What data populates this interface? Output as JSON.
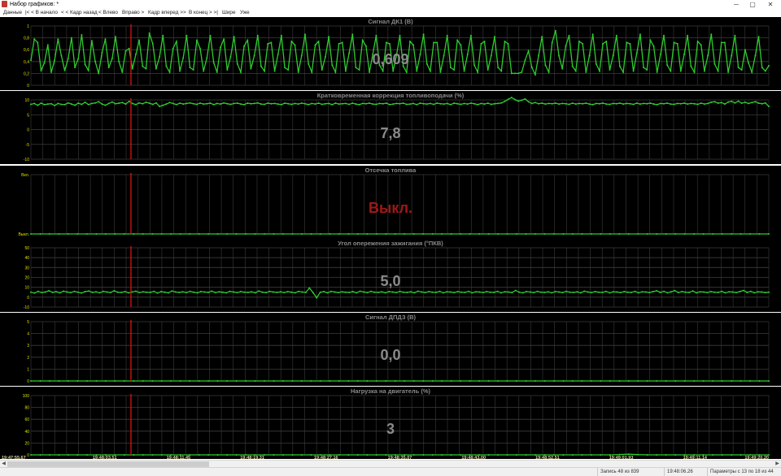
{
  "window": {
    "title": "Набор графиков: *",
    "minimize": "─",
    "maximize": "▢",
    "close": "✕"
  },
  "menu": [
    "Данные",
    "|< < В начало",
    "< < Кадр назад",
    "< Влево",
    "Вправо >",
    "Кадр вперед >>",
    "В конец > >|",
    "Шире",
    "Уже"
  ],
  "colors": {
    "background": "#000000",
    "grid": "#3c3c3c",
    "series": "#2ecc2e",
    "cursor": "#e01010",
    "title": "#8a8a8a",
    "big_value": "#8a8a8a",
    "big_value_alert": "#a01818",
    "axis_text": "#e0e000",
    "x_text": "#d6d6a0"
  },
  "x_axis": {
    "time_labels": [
      "19:47:55.67",
      "19:48:03.51",
      "19:48:11.45",
      "19:48:19.31",
      "19:48:27.16",
      "19:48:35.07",
      "19:48:43.00",
      "19:48:52.51",
      "19:49:01.93",
      "19:49:11.14",
      "19:49:20.20"
    ]
  },
  "chart_data": [
    {
      "type": "line",
      "title": "Сигнал ДК1  (В)",
      "current_value": "0,609",
      "y_ticks": [
        "1",
        "0,8",
        "0,6",
        "0,4",
        "0,2",
        "0"
      ],
      "ylim": [
        0,
        1
      ],
      "grid": true,
      "series": [
        {
          "values": [
            0.42,
            0.78,
            0.72,
            0.25,
            0.38,
            0.68,
            0.22,
            0.42,
            0.78,
            0.5,
            0.25,
            0.45,
            0.8,
            0.3,
            0.45,
            0.85,
            0.35,
            0.25,
            0.75,
            0.4,
            0.2,
            0.55,
            0.78,
            0.3,
            0.45,
            0.82,
            0.4,
            0.22,
            0.58,
            0.62,
            0.28,
            0.52,
            0.76,
            0.32,
            0.28,
            0.88,
            0.7,
            0.28,
            0.48,
            0.84,
            0.32,
            0.22,
            0.62,
            0.74,
            0.24,
            0.46,
            0.84,
            0.3,
            0.26,
            0.76,
            0.62,
            0.24,
            0.46,
            0.84,
            0.38,
            0.22,
            0.64,
            0.78,
            0.26,
            0.48,
            0.82,
            0.36,
            0.22,
            0.66,
            0.76,
            0.28,
            0.5,
            0.84,
            0.32,
            0.24,
            0.7,
            0.72,
            0.24,
            0.52,
            0.84,
            0.3,
            0.26,
            0.74,
            0.68,
            0.22,
            0.5,
            0.86,
            0.36,
            0.22,
            0.68,
            0.74,
            0.26,
            0.48,
            0.82,
            0.34,
            0.22,
            0.7,
            0.72,
            0.24,
            0.54,
            0.86,
            0.3,
            0.26,
            0.76,
            0.66,
            0.22,
            0.52,
            0.84,
            0.34,
            0.24,
            0.72,
            0.7,
            0.24,
            0.5,
            0.84,
            0.32,
            0.22,
            0.74,
            0.68,
            0.24,
            0.52,
            0.86,
            0.36,
            0.24,
            0.72,
            0.72,
            0.22,
            0.5,
            0.84,
            0.3,
            0.26,
            0.76,
            0.68,
            0.24,
            0.52,
            0.84,
            0.34,
            0.22,
            0.7,
            0.74,
            0.26,
            0.5,
            0.82,
            0.3,
            0.24,
            0.74,
            0.7,
            0.2,
            0.2,
            0.2,
            0.22,
            0.42,
            0.58,
            0.3,
            0.18,
            0.5,
            0.82,
            0.34,
            0.22,
            0.72,
            0.92,
            0.5,
            0.28,
            0.66,
            0.84,
            0.32,
            0.24,
            0.74,
            0.7,
            0.22,
            0.5,
            0.86,
            0.36,
            0.24,
            0.7,
            0.74,
            0.26,
            0.5,
            0.84,
            0.32,
            0.22,
            0.72,
            0.7,
            0.24,
            0.54,
            0.86,
            0.3,
            0.26,
            0.76,
            0.66,
            0.22,
            0.52,
            0.84,
            0.34,
            0.24,
            0.72,
            0.7,
            0.24,
            0.52,
            0.84,
            0.32,
            0.22,
            0.74,
            0.68,
            0.24,
            0.5,
            0.86,
            0.36,
            0.24,
            0.72,
            0.72,
            0.22,
            0.5,
            0.84,
            0.3,
            0.26,
            0.6,
            0.38,
            0.22,
            0.5,
            0.82,
            0.3,
            0.24,
            0.33
          ]
        }
      ]
    },
    {
      "type": "line",
      "title": "Кратковременная коррекция топливоподачи  (%)",
      "current_value": "7,8",
      "y_ticks": [
        "10",
        "5",
        "0",
        "-5",
        "-10"
      ],
      "ylim": [
        -10,
        10
      ],
      "grid": true,
      "series": [
        {
          "values": [
            8.5,
            8.8,
            8.2,
            8.9,
            8.4,
            8.6,
            8.7,
            8.1,
            8.8,
            8.5,
            8.4,
            9.0,
            8.6,
            8.2,
            8.9,
            8.5,
            9.2,
            8.4,
            8.8,
            9.0,
            9.4,
            8.6,
            8.2,
            8.8,
            9.3,
            8.7,
            8.9,
            9.1,
            8.6,
            9.5,
            8.8,
            8.4,
            9.0,
            8.7,
            9.2,
            8.9,
            8.5,
            9.0,
            7.8,
            8.2,
            8.6,
            9.1,
            8.8,
            8.4,
            8.9,
            8.6,
            8.8,
            9.0,
            8.7,
            8.5,
            8.9,
            8.6,
            8.7,
            8.9,
            8.4,
            8.8,
            8.6,
            9.0,
            8.7,
            8.5,
            8.8,
            8.9,
            8.6,
            8.4,
            8.9,
            8.7,
            8.8,
            9.0,
            8.6,
            8.5,
            8.9,
            8.7,
            8.8,
            8.6,
            8.4,
            8.9,
            8.7,
            8.5,
            8.8,
            8.6,
            8.9,
            8.7,
            8.4,
            8.8,
            8.6,
            8.9,
            8.5,
            8.7,
            8.8,
            8.4,
            8.9,
            8.6,
            8.7,
            8.8,
            8.5,
            8.9,
            8.6,
            8.4,
            8.8,
            8.7,
            8.9,
            8.6,
            8.5,
            8.8,
            8.7,
            8.9,
            8.4,
            8.6,
            8.8,
            8.7,
            8.9,
            8.5,
            8.6,
            8.8,
            8.4,
            8.9,
            8.7,
            8.6,
            8.8,
            8.5,
            8.9,
            8.7,
            8.6,
            8.8,
            8.4,
            8.9,
            8.7,
            8.5,
            8.8,
            8.6,
            8.9,
            8.7,
            8.4,
            8.8,
            8.6,
            8.9,
            8.5,
            8.7,
            8.8,
            9.0,
            9.5,
            10.2,
            10.8,
            10.1,
            9.6,
            9.9,
            10.3,
            9.4,
            8.8,
            9.1,
            8.7,
            8.9,
            8.6,
            8.8,
            8.7,
            8.9,
            8.6,
            8.8,
            8.7,
            8.5,
            8.9,
            8.6,
            8.8,
            8.7,
            8.9,
            8.6,
            8.4,
            8.8,
            8.7,
            8.9,
            8.6,
            8.5,
            8.8,
            8.7,
            8.9,
            8.6,
            8.8,
            8.7,
            8.5,
            8.9,
            8.6,
            8.8,
            8.7,
            8.9,
            8.6,
            8.4,
            8.8,
            8.7,
            8.9,
            8.6,
            8.5,
            8.8,
            8.7,
            8.9,
            8.6,
            8.8,
            8.7,
            8.5,
            8.9,
            8.6,
            8.8,
            9.2,
            9.4,
            8.9,
            9.1,
            8.6,
            9.3,
            9.5,
            9.0,
            9.6,
            8.9,
            9.2,
            8.8,
            9.1,
            9.4,
            8.9,
            8.7,
            9.0,
            7.8
          ]
        }
      ]
    },
    {
      "type": "line",
      "title": "Отсечка топлива",
      "current_value": "Выкл.",
      "y_ticks": [
        "Вкл.",
        "Выкл."
      ],
      "ylim": [
        0,
        1
      ],
      "grid": true,
      "series": [
        {
          "values": [
            0,
            0,
            0,
            0,
            0,
            0,
            0,
            0,
            0,
            0,
            0,
            0,
            0,
            0,
            0,
            0,
            0,
            0,
            0,
            0,
            0,
            0,
            0,
            0,
            0,
            0,
            0,
            0,
            0,
            0,
            0,
            0,
            0,
            0,
            0,
            0,
            0,
            0,
            0,
            0,
            0,
            0,
            0,
            0,
            0,
            0,
            0,
            0,
            0,
            0,
            0,
            0,
            0,
            0,
            0,
            0,
            0,
            0,
            0,
            0,
            0,
            0,
            0,
            0,
            0,
            0,
            0,
            0,
            0,
            0,
            0,
            0,
            0,
            0,
            0,
            0,
            0,
            0,
            0,
            0
          ]
        }
      ]
    },
    {
      "type": "line",
      "title": "Угол опережения зажигания  (°ПКВ)",
      "current_value": "5,0",
      "y_ticks": [
        "50",
        "40",
        "30",
        "20",
        "10",
        "0",
        "-10"
      ],
      "ylim": [
        -10,
        50
      ],
      "grid": true,
      "series": [
        {
          "values": [
            5.0,
            4.2,
            5.8,
            4.6,
            5.2,
            6.4,
            4.8,
            5.5,
            4.4,
            6.0,
            5.2,
            4.6,
            5.8,
            5.0,
            4.2,
            5.6,
            6.2,
            4.8,
            5.4,
            4.4,
            5.8,
            5.2,
            4.6,
            6.4,
            5.0,
            4.8,
            5.6,
            4.4,
            5.2,
            6.0,
            4.6,
            5.4,
            5.0,
            4.8,
            5.8,
            4.2,
            5.6,
            5.0,
            4.4,
            6.2,
            5.2,
            4.8,
            5.4,
            4.6,
            5.8,
            5.0,
            4.4,
            5.6,
            5.2,
            4.8,
            6.0,
            4.6,
            5.4,
            5.0,
            4.4,
            5.8,
            5.2,
            4.6,
            5.6,
            5.0,
            4.8,
            5.4,
            4.4,
            6.2,
            5.0,
            4.6,
            5.8,
            5.2,
            4.8,
            5.4,
            4.6,
            5.6,
            5.0,
            4.4,
            5.8,
            5.2,
            4.8,
            9.2,
            4.6,
            -0.6,
            5.0,
            5.6,
            4.4,
            5.8,
            5.2,
            4.6,
            5.4,
            5.0,
            4.8,
            5.6,
            4.4,
            6.0,
            5.2,
            4.6,
            5.8,
            5.0,
            4.8,
            5.4,
            4.4,
            5.6,
            5.2,
            4.6,
            5.8,
            5.0,
            4.8,
            5.4,
            4.4,
            6.0,
            5.2,
            4.6,
            5.6,
            5.0,
            4.8,
            5.8,
            4.4,
            5.4,
            5.2,
            4.6,
            5.6,
            5.0,
            4.8,
            5.8,
            4.4,
            5.4,
            5.2,
            4.6,
            5.6,
            5.0,
            4.8,
            5.8,
            4.4,
            5.4,
            5.2,
            4.6,
            6.8,
            5.0,
            4.4,
            5.6,
            5.2,
            4.6,
            5.8,
            5.0,
            4.8,
            5.4,
            4.4,
            5.6,
            5.2,
            4.6,
            5.8,
            5.0,
            4.8,
            5.4,
            4.4,
            6.0,
            5.2,
            4.6,
            5.6,
            5.0,
            4.8,
            5.8,
            4.4,
            5.4,
            5.2,
            4.6,
            5.6,
            5.0,
            4.8,
            5.8,
            4.4,
            5.4,
            5.2,
            4.6,
            5.6,
            6.4,
            4.8,
            5.8,
            4.4,
            5.4,
            6.6,
            4.6,
            5.6,
            5.0,
            4.8,
            6.2,
            4.4,
            5.4,
            5.2,
            4.6,
            5.6,
            5.0,
            4.8,
            5.8,
            4.4,
            5.4,
            5.2,
            4.6,
            5.6,
            6.8,
            4.8,
            5.8,
            4.4,
            5.4,
            5.2,
            4.6,
            5.0
          ]
        }
      ]
    },
    {
      "type": "line",
      "title": "Сигнал ДПДЗ  (В)",
      "current_value": "0,0",
      "y_ticks": [
        "5",
        "4",
        "3",
        "2",
        "1",
        "0"
      ],
      "ylim": [
        0,
        5
      ],
      "grid": true,
      "series": [
        {
          "values": [
            0,
            0,
            0,
            0,
            0,
            0,
            0,
            0,
            0,
            0,
            0,
            0,
            0,
            0,
            0,
            0,
            0,
            0,
            0,
            0,
            0,
            0,
            0,
            0,
            0,
            0,
            0,
            0,
            0,
            0,
            0,
            0,
            0,
            0,
            0,
            0,
            0,
            0,
            0,
            0,
            0,
            0,
            0,
            0,
            0,
            0,
            0,
            0,
            0,
            0,
            0,
            0,
            0,
            0,
            0,
            0,
            0,
            0,
            0,
            0,
            0,
            0,
            0,
            0,
            0,
            0,
            0,
            0,
            0,
            0,
            0,
            0,
            0,
            0,
            0,
            0,
            0,
            0,
            0,
            0
          ]
        }
      ]
    },
    {
      "type": "line",
      "title": "Нагрузка на двигатель  (%)",
      "current_value": "3",
      "y_ticks": [
        "100",
        "80",
        "60",
        "40",
        "20",
        "0"
      ],
      "ylim": [
        0,
        100
      ],
      "grid": true,
      "series": [
        {
          "values": [
            0,
            0,
            0,
            0,
            0,
            0,
            0,
            0,
            0,
            0,
            0,
            0,
            0,
            0,
            0,
            0,
            0,
            0,
            0,
            0,
            0,
            0,
            0,
            0,
            0,
            0,
            0,
            0,
            0,
            0,
            0,
            0,
            0,
            0,
            0,
            0,
            0,
            0,
            0,
            0,
            0,
            0,
            0,
            0,
            0,
            0,
            0,
            0,
            0,
            0,
            0,
            0,
            0,
            0,
            0,
            0,
            0,
            0,
            0,
            0,
            0,
            0,
            0,
            0.6,
            1.2,
            0.4,
            0,
            0,
            0,
            0,
            0,
            0,
            0,
            0,
            0,
            0,
            0,
            0,
            0,
            0
          ]
        }
      ]
    }
  ],
  "status": {
    "record": "Запись 48 из 839",
    "time": "19:48:06.26",
    "params": "Параметры с 13 по 18 из 44"
  }
}
